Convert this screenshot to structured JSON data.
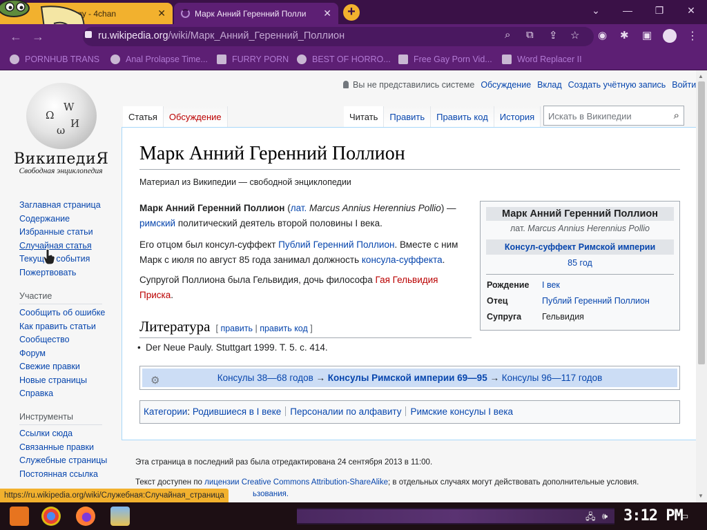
{
  "browser": {
    "tabs": [
      {
        "title": "ology - 4chan",
        "active": false
      },
      {
        "title": "Марк Анний Геренний Полли",
        "active": true
      }
    ],
    "new_tab_icon": "plus-icon",
    "url_host": "ru.wikipedia.org",
    "url_path": "/wiki/Марк_Анний_Геренний_Поллион",
    "bookmarks": [
      "PORNHUB TRANS",
      "Anal Prolapse Time...",
      "FURRY PORN",
      "BEST OF HORRO...",
      "Free Gay Porn Vid...",
      "Word Replacer II"
    ],
    "status_url": "https://ru.wikipedia.org/wiki/Служебная:Случайная_страница",
    "accent_color": "#5d1f74",
    "tab_color": "#f2b12e"
  },
  "wiki": {
    "logo_title": "ВикипедиЯ",
    "logo_tagline": "Свободная энциклопедия",
    "globe_glyphs": [
      "Ω",
      "W",
      "И",
      "ω"
    ],
    "nav_main": [
      "Заглавная страница",
      "Содержание",
      "Избранные статьи",
      "Случайная статья",
      "Текущие события",
      "Пожертвовать"
    ],
    "nav_participation_heading": "Участие",
    "nav_participation": [
      "Сообщить об ошибке",
      "Как править статьи",
      "Сообщество",
      "Форум",
      "Свежие правки",
      "Новые страницы",
      "Справка"
    ],
    "nav_tools_heading": "Инструменты",
    "nav_tools": [
      "Ссылки сюда",
      "Связанные правки",
      "Служебные страницы",
      "Постоянная ссылка"
    ],
    "user_status": "Вы не представились системе",
    "user_links": [
      "Обсуждение",
      "Вклад",
      "Создать учётную запись",
      "Войти"
    ],
    "ns_tabs": [
      "Статья",
      "Обсуждение"
    ],
    "view_tabs": [
      "Читать",
      "Править",
      "Править код",
      "История"
    ],
    "search_placeholder": "Искать в Википедии",
    "title": "Марк Анний Геренний Поллион",
    "site_sub": "Материал из Википедии — свободной энциклопедии",
    "p1": {
      "bold": "Марк Анний Геренний Поллион",
      "open": " (",
      "lat": "лат.",
      "latin": " Marcus Annius Herennius Pollio",
      "close": ") —",
      "roman": "римский",
      "rest": " политический деятель второй половины I века."
    },
    "p2": {
      "a": "Его отцом был консул-суффект ",
      "father": "Публий Геренний Поллион",
      "b": ". Вместе с ним Марк с июля по август 85 года занимал должность ",
      "office": "консула-суффекта",
      "c": "."
    },
    "p3": {
      "a": "Супругой Поллиона была Гельвидия, дочь философа ",
      "link": "Гая Гельвидия Приска",
      "b": "."
    },
    "lit_heading": "Литература",
    "lit_edit": [
      "править",
      "править код"
    ],
    "lit_item": "Der Neue Pauly. Stuttgart 1999. T. 5. с. 414.",
    "infobox": {
      "title": "Марк Анний Геренний Поллион",
      "lat": "лат.",
      "latin": "Marcus Annius Herennius Pollio",
      "office": "Консул-суффект Римской империи",
      "year": "85 год",
      "rows": [
        {
          "label": "Рождение",
          "value": "I век"
        },
        {
          "label": "Отец",
          "value": "Публий Геренний Поллион"
        },
        {
          "label": "Супруга",
          "value": "Гельвидия"
        }
      ]
    },
    "navbox": {
      "prev": "Консулы 38—68 годов",
      "current": "Консулы Римской империи 69—95",
      "next": "Консулы 96—117 годов",
      "arrow": "→"
    },
    "categories_label": "Категории",
    "categories": [
      "Родившиеся в I веке",
      "Персоналии по алфавиту",
      "Римские консулы I века"
    ],
    "footer_edited": "Эта страница в последний раз была отредактирована 24 сентября 2013 в 11:00.",
    "footer_license_a": "Текст доступен по ",
    "footer_license_link": "лицензии Creative Commons Attribution-ShareAlike",
    "footer_license_b": "; в отдельных случаях могут действовать дополнительные условия.",
    "footer_terms_tail": "ьзования."
  },
  "taskbar": {
    "clock": "3:12 PM"
  }
}
